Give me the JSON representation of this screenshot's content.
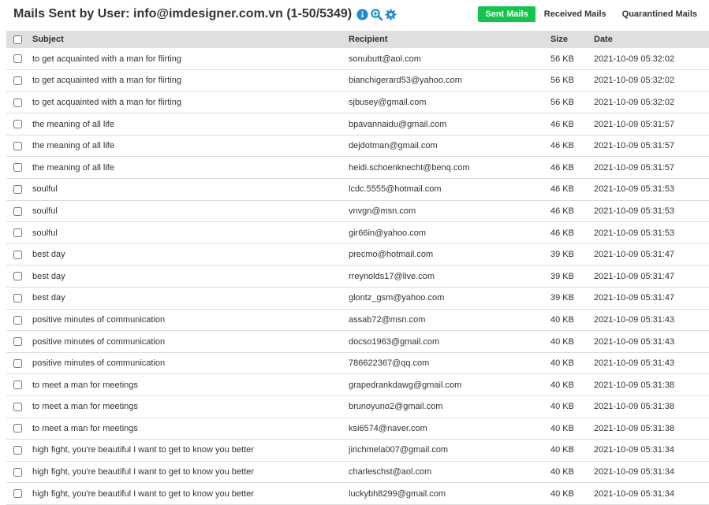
{
  "header": {
    "title": "Mails Sent by User: info@imdesigner.com.vn (1-50/5349)",
    "icons": [
      "info-icon",
      "search-zoom-icon",
      "gear-icon"
    ]
  },
  "tabs": [
    {
      "label": "Sent Mails",
      "active": true
    },
    {
      "label": "Received Mails",
      "active": false
    },
    {
      "label": "Quarantined Mails",
      "active": false
    }
  ],
  "colors": {
    "accent": "#14c44c",
    "icon_blue": "#1a8ccf"
  },
  "table": {
    "columns": {
      "subject": "Subject",
      "recipient": "Recipient",
      "size": "Size",
      "date": "Date"
    },
    "rows": [
      {
        "subject": "to get acquainted with a man for flirting",
        "recipient": "sonubutt@aol.com",
        "size": "56 KB",
        "date": "2021-10-09 05:32:02"
      },
      {
        "subject": "to get acquainted with a man for flirting",
        "recipient": "bianchigerard53@yahoo.com",
        "size": "56 KB",
        "date": "2021-10-09 05:32:02"
      },
      {
        "subject": "to get acquainted with a man for flirting",
        "recipient": "sjbusey@gmail.com",
        "size": "56 KB",
        "date": "2021-10-09 05:32:02"
      },
      {
        "subject": "the meaning of all life",
        "recipient": "bpavannaidu@gmail.com",
        "size": "46 KB",
        "date": "2021-10-09 05:31:57"
      },
      {
        "subject": "the meaning of all life",
        "recipient": "dejdotman@gmail.com",
        "size": "46 KB",
        "date": "2021-10-09 05:31:57"
      },
      {
        "subject": "the meaning of all life",
        "recipient": "heidi.schoenknecht@benq.com",
        "size": "46 KB",
        "date": "2021-10-09 05:31:57"
      },
      {
        "subject": "soulful",
        "recipient": "lcdc.5555@hotmail.com",
        "size": "46 KB",
        "date": "2021-10-09 05:31:53"
      },
      {
        "subject": "soulful",
        "recipient": "vnvgn@msn.com",
        "size": "46 KB",
        "date": "2021-10-09 05:31:53"
      },
      {
        "subject": "soulful",
        "recipient": "gir66in@yahoo.com",
        "size": "46 KB",
        "date": "2021-10-09 05:31:53"
      },
      {
        "subject": "best day",
        "recipient": "precmo@hotmail.com",
        "size": "39 KB",
        "date": "2021-10-09 05:31:47"
      },
      {
        "subject": "best day",
        "recipient": "rreynolds17@live.com",
        "size": "39 KB",
        "date": "2021-10-09 05:31:47"
      },
      {
        "subject": "best day",
        "recipient": "glontz_gsm@yahoo.com",
        "size": "39 KB",
        "date": "2021-10-09 05:31:47"
      },
      {
        "subject": "positive minutes of communication",
        "recipient": "assab72@msn.com",
        "size": "40 KB",
        "date": "2021-10-09 05:31:43"
      },
      {
        "subject": "positive minutes of communication",
        "recipient": "docso1963@gmail.com",
        "size": "40 KB",
        "date": "2021-10-09 05:31:43"
      },
      {
        "subject": "positive minutes of communication",
        "recipient": "786622367@qq.com",
        "size": "40 KB",
        "date": "2021-10-09 05:31:43"
      },
      {
        "subject": "to meet a man for meetings",
        "recipient": "grapedrankdawg@gmail.com",
        "size": "40 KB",
        "date": "2021-10-09 05:31:38"
      },
      {
        "subject": "to meet a man for meetings",
        "recipient": "brunoyuno2@gmail.com",
        "size": "40 KB",
        "date": "2021-10-09 05:31:38"
      },
      {
        "subject": "to meet a man for meetings",
        "recipient": "ksi6574@naver.com",
        "size": "40 KB",
        "date": "2021-10-09 05:31:38"
      },
      {
        "subject": "high fight, you're beautiful I want to get to know you better",
        "recipient": "jirichmela007@gmail.com",
        "size": "40 KB",
        "date": "2021-10-09 05:31:34"
      },
      {
        "subject": "high fight, you're beautiful I want to get to know you better",
        "recipient": "charleschst@aol.com",
        "size": "40 KB",
        "date": "2021-10-09 05:31:34"
      },
      {
        "subject": "high fight, you're beautiful I want to get to know you better",
        "recipient": "luckybh8299@gmail.com",
        "size": "40 KB",
        "date": "2021-10-09 05:31:34"
      }
    ]
  }
}
